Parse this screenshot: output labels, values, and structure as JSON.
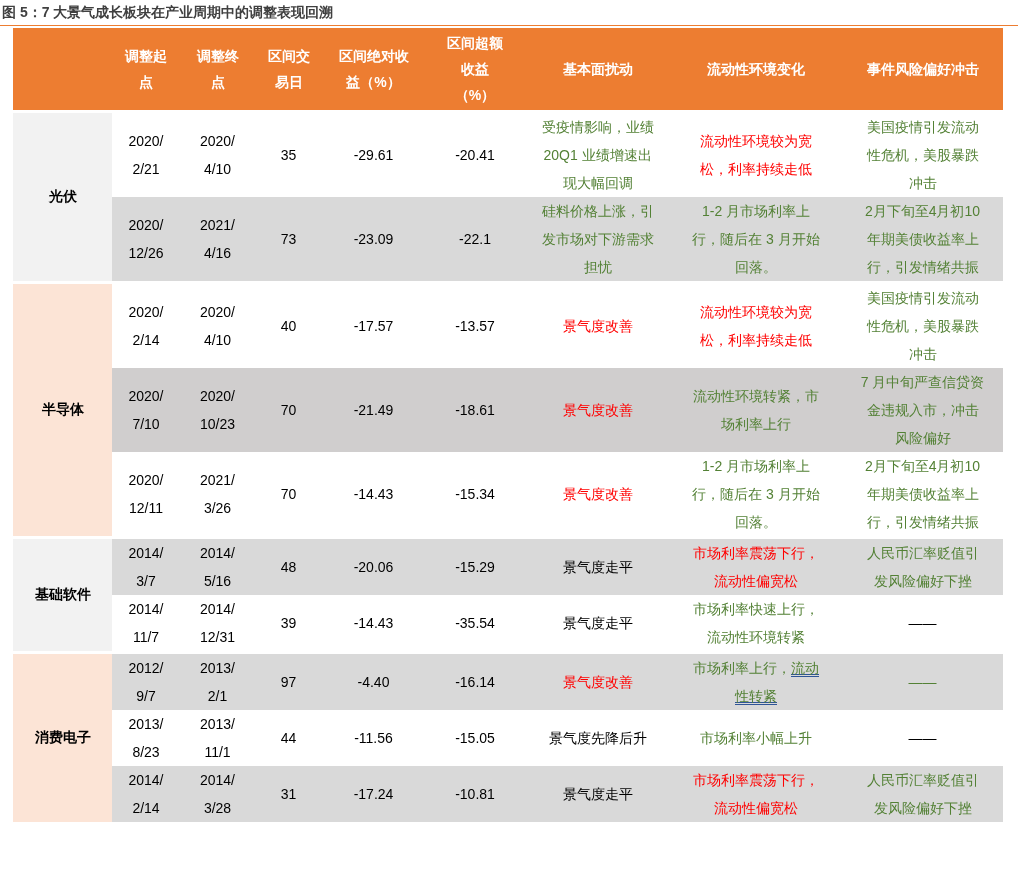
{
  "title": "图 5：7 大景气成长板块在产业周期中的调整表现回溯",
  "columns": [
    "",
    "调整起点",
    "调整终点",
    "区间交易日",
    "区间绝对收益（%）",
    "区间超额收益（%）",
    "基本面扰动",
    "流动性环境变化",
    "事件风险偏好冲击"
  ],
  "groups": [
    {
      "sector": "光伏",
      "color": "#f2f2f2",
      "rows": [
        {
          "color": "#ffffff",
          "cells": [
            {
              "text": "2020/2/21"
            },
            {
              "text": "2020/4/10"
            },
            {
              "text": "35"
            },
            {
              "text": "-29.61"
            },
            {
              "text": "-20.41"
            },
            {
              "text": "受疫情影响，业绩20Q1 业绩增速出现大幅回调",
              "color": "#538135"
            },
            {
              "text": "流动性环境较为宽松，利率持续走低",
              "color": "#ff0000"
            },
            {
              "text": "美国疫情引发流动性危机，美股暴跌冲击",
              "color": "#538135"
            }
          ]
        },
        {
          "color": "#d9d9d9",
          "cells": [
            {
              "text": "2020/12/26"
            },
            {
              "text": "2021/4/16"
            },
            {
              "text": "73"
            },
            {
              "text": "-23.09"
            },
            {
              "text": "-22.1"
            },
            {
              "text": "硅料价格上涨，引发市场对下游需求担忧",
              "color": "#538135"
            },
            {
              "text": "1-2 月市场利率上行，随后在 3 月开始回落。",
              "color": "#538135"
            },
            {
              "text": "2月下旬至4月初10年期美债收益率上行，引发情绪共振",
              "color": "#538135"
            }
          ]
        }
      ]
    },
    {
      "sector": "半导体",
      "color": "#fce4d6",
      "rows": [
        {
          "color": "#ffffff",
          "cells": [
            {
              "text": "2020/2/14"
            },
            {
              "text": "2020/4/10"
            },
            {
              "text": "40"
            },
            {
              "text": "-17.57"
            },
            {
              "text": "-13.57"
            },
            {
              "text": "景气度改善",
              "color": "#ff0000"
            },
            {
              "text": "流动性环境较为宽松，利率持续走低",
              "color": "#ff0000"
            },
            {
              "text": "美国疫情引发流动性危机，美股暴跌冲击",
              "color": "#538135"
            }
          ]
        },
        {
          "color": "#d0cece",
          "cells": [
            {
              "text": "2020/7/10"
            },
            {
              "text": "2020/10/23"
            },
            {
              "text": "70"
            },
            {
              "text": "-21.49"
            },
            {
              "text": "-18.61"
            },
            {
              "text": "景气度改善",
              "color": "#ff0000"
            },
            {
              "text": "流动性环境转紧，市场利率上行",
              "color": "#538135"
            },
            {
              "text": "7 月中旬严查信贷资金违规入市，冲击风险偏好",
              "color": "#538135"
            }
          ]
        },
        {
          "color": "#ffffff",
          "cells": [
            {
              "text": "2020/12/11"
            },
            {
              "text": "2021/3/26"
            },
            {
              "text": "70"
            },
            {
              "text": "-14.43"
            },
            {
              "text": "-15.34"
            },
            {
              "text": "景气度改善",
              "color": "#ff0000"
            },
            {
              "text": "1-2 月市场利率上行，随后在 3 月开始回落。",
              "color": "#538135"
            },
            {
              "text": "2月下旬至4月初10年期美债收益率上行，引发情绪共振",
              "color": "#538135"
            }
          ]
        }
      ]
    },
    {
      "sector": "基础软件",
      "color": "#f2f2f2",
      "rows": [
        {
          "color": "#d9d9d9",
          "cells": [
            {
              "text": "2014/3/7"
            },
            {
              "text": "2014/5/16"
            },
            {
              "text": "48"
            },
            {
              "text": "-20.06"
            },
            {
              "text": "-15.29"
            },
            {
              "text": "景气度走平",
              "color": "#000000"
            },
            {
              "text": "市场利率震荡下行，流动性偏宽松",
              "color": "#ff0000"
            },
            {
              "text": "人民币汇率贬值引发风险偏好下挫",
              "color": "#538135"
            }
          ]
        },
        {
          "color": "#ffffff",
          "cells": [
            {
              "text": "2014/11/7"
            },
            {
              "text": "2014/12/31"
            },
            {
              "text": "39"
            },
            {
              "text": "-14.43"
            },
            {
              "text": "-35.54"
            },
            {
              "text": "景气度走平",
              "color": "#000000"
            },
            {
              "text": "市场利率快速上行，流动性环境转紧",
              "color": "#538135"
            },
            {
              "text": "——",
              "color": "#000000"
            }
          ]
        }
      ]
    },
    {
      "sector": "消费电子",
      "color": "#fce4d6",
      "rows": [
        {
          "color": "#d9d9d9",
          "cells": [
            {
              "text": "2012/9/7"
            },
            {
              "text": "2013/2/1"
            },
            {
              "text": "97"
            },
            {
              "text": "-4.40"
            },
            {
              "text": "-16.14"
            },
            {
              "text": "景气度改善",
              "color": "#ff0000"
            },
            {
              "segments": [
                {
                  "text": "市场利率上行，",
                  "underlined": false
                },
                {
                  "text": "流动性转紧",
                  "underlined": true
                }
              ],
              "color": "#538135"
            },
            {
              "text": "——",
              "color": "#538135"
            }
          ]
        },
        {
          "color": "#ffffff",
          "cells": [
            {
              "text": "2013/8/23"
            },
            {
              "text": "2013/11/1"
            },
            {
              "text": "44"
            },
            {
              "text": "-11.56"
            },
            {
              "text": "-15.05"
            },
            {
              "text": "景气度先降后升",
              "color": "#000000"
            },
            {
              "text": "市场利率小幅上升",
              "color": "#538135"
            },
            {
              "text": "——",
              "color": "#000000"
            }
          ]
        },
        {
          "color": "#d9d9d9",
          "cells": [
            {
              "text": "2014/2/14"
            },
            {
              "text": "2014/3/28"
            },
            {
              "text": "31"
            },
            {
              "text": "-17.24"
            },
            {
              "text": "-10.81"
            },
            {
              "text": "景气度走平",
              "color": "#000000"
            },
            {
              "text": "市场利率震荡下行，流动性偏宽松",
              "color": "#ff0000"
            },
            {
              "text": "人民币汇率贬值引发风险偏好下挫",
              "color": "#538135"
            }
          ]
        }
      ]
    }
  ]
}
